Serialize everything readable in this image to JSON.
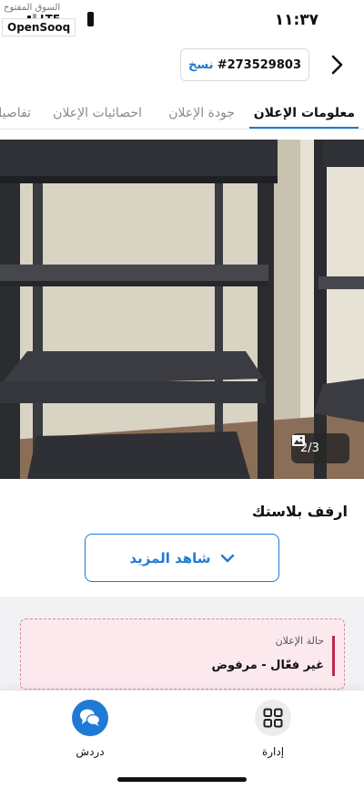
{
  "status_bar": {
    "time": "١١:٣٧",
    "network": "LTE",
    "watermark_text": "السوق المفتوح",
    "logo_text": "OpenSooq"
  },
  "header": {
    "copy_label": "نسخ",
    "ad_id": "#273529803",
    "back_icon": "chevron-right-icon"
  },
  "tabs": [
    {
      "label": "معلومات الإعلان",
      "active": true
    },
    {
      "label": "جودة الإعلان",
      "active": false
    },
    {
      "label": "احصائيات الإعلان",
      "active": false
    },
    {
      "label": "تفاصيل",
      "active": false
    }
  ],
  "gallery": {
    "counter": "2/3",
    "counter_icon": "image-icon"
  },
  "listing": {
    "title": "ارفف بلاستك",
    "see_more_label": "شاهد المزيد"
  },
  "ad_status": {
    "caption": "حالة الإعلان",
    "value": "غير فعّال - مرفوض"
  },
  "bottom_nav": {
    "manage_label": "إدارة",
    "chat_label": "دردش"
  },
  "colors": {
    "accent": "#1f7ad6",
    "status_border": "#d98aa0",
    "status_bg": "#fbe9ee",
    "status_accent": "#c0244c"
  }
}
